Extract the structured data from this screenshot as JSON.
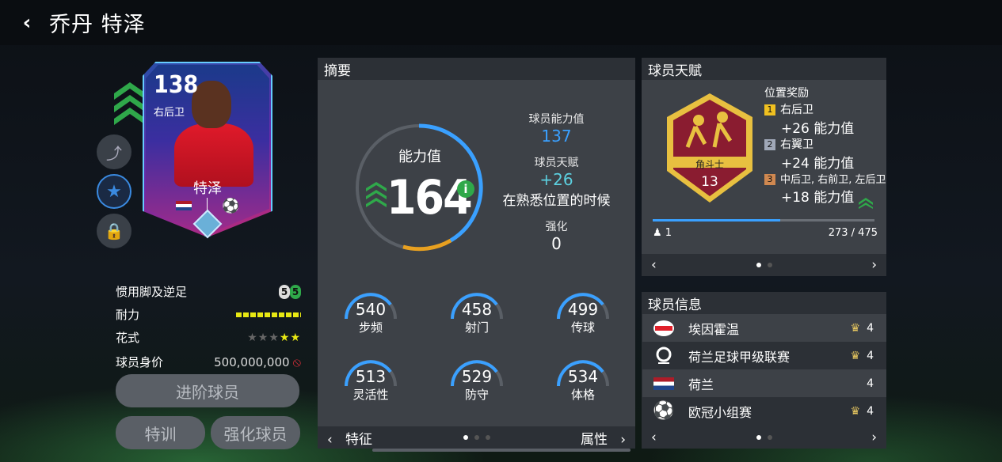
{
  "header": {
    "back": "‹",
    "title": "乔丹 特泽"
  },
  "card": {
    "rating": "138",
    "position": "右后卫",
    "name": "特泽",
    "league_ball": "⚽"
  },
  "attributes": {
    "weak_foot_label": "惯用脚及逆足",
    "weak_foot_left": "5",
    "weak_foot_right": "5",
    "stamina_label": "耐力",
    "skills_label": "花式",
    "skills_stars": 2,
    "value_label": "球员身价",
    "value": "500,000,000"
  },
  "buttons": {
    "upgrade": "进阶球员",
    "training": "特训",
    "enhance": "强化球员"
  },
  "summary": {
    "title": "摘要",
    "ovr_label": "能力值",
    "ovr_value": "164",
    "player_ovr_label": "球员能力值",
    "player_ovr_value": "137",
    "trait_label": "球员天赋",
    "trait_value": "+26",
    "trait_note": "在熟悉位置的时候",
    "boost_label": "强化",
    "boost_value": "0",
    "stats": [
      {
        "value": "540",
        "label": "步频"
      },
      {
        "value": "458",
        "label": "射门"
      },
      {
        "value": "499",
        "label": "传球"
      },
      {
        "value": "513",
        "label": "灵活性"
      },
      {
        "value": "529",
        "label": "防守"
      },
      {
        "value": "534",
        "label": "体格"
      }
    ],
    "footer_left": "特征",
    "footer_right": "属性"
  },
  "talent": {
    "title": "球员天赋",
    "badge_name": "角斗士",
    "badge_level": "13",
    "reward_title": "位置奖励",
    "rewards": [
      {
        "rank": "1",
        "positions": "右后卫",
        "value": "+26 能力值",
        "color": "#f0c020"
      },
      {
        "rank": "2",
        "positions": "右翼卫",
        "value": "+24 能力值",
        "color": "#a0a8b8"
      },
      {
        "rank": "3",
        "positions": "中后卫, 右前卫, 左后卫",
        "value": "+18 能力值",
        "color": "#d08850"
      }
    ],
    "progress_left": "1",
    "progress_right": "273 / 475",
    "progress_fraction": 0.575
  },
  "info": {
    "title": "球员信息",
    "rows": [
      {
        "name": "埃因霍温",
        "count": "4"
      },
      {
        "name": "荷兰足球甲级联赛",
        "count": "4"
      },
      {
        "name": "荷兰",
        "count": "4"
      },
      {
        "name": "欧冠小组赛",
        "count": "4"
      }
    ]
  },
  "colors": {
    "accent_blue": "#3aa0ff",
    "green": "#2fa84a",
    "gold": "#e8c860"
  }
}
